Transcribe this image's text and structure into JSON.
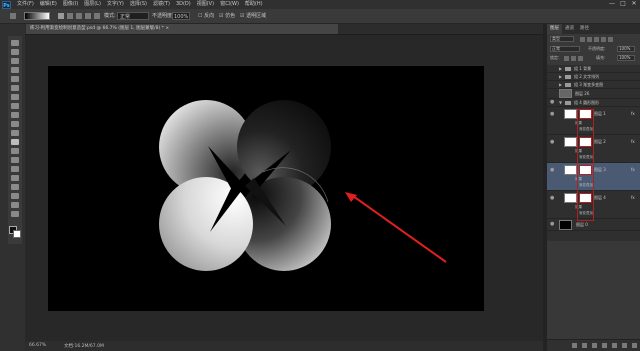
{
  "app": {
    "logo": "Ps"
  },
  "menu": [
    "文件(F)",
    "编辑(E)",
    "图像(I)",
    "图层(L)",
    "文字(Y)",
    "选择(S)",
    "滤镜(T)",
    "3D(D)",
    "视图(V)",
    "窗口(W)",
    "帮助(H)"
  ],
  "window_controls": [
    "—",
    "□",
    "✕"
  ],
  "options_bar": {
    "mode_label": "模式:",
    "mode_value": "正常",
    "opacity_label": "不透明度:",
    "opacity_value": "100%",
    "reverse_label": "反向",
    "dither_label": "仿色",
    "transparency_label": "透明区域"
  },
  "document_tab": {
    "title": "练习-利用渐变绘制创意造型.psd @ 66.7% (图层 1, 图层蒙版/8) * ×"
  },
  "status_bar": {
    "zoom": "66.67%",
    "doc_size": "文档:16.2M/67.0M"
  },
  "panels": {
    "tabs": [
      "图层",
      "通道",
      "路径"
    ],
    "kind_label": "类型",
    "mode_value": "正常",
    "opacity_label": "不透明度:",
    "opacity_value": "100%",
    "lock_label": "锁定:",
    "fill_label": "填充:",
    "fill_value": "100%",
    "layers": [
      {
        "name": "组 1 背景",
        "type": "group"
      },
      {
        "name": "组 2 文字排列",
        "type": "group"
      },
      {
        "name": "组 3 渐变多变图",
        "type": "group"
      },
      {
        "name": "图层 26",
        "type": "layer"
      },
      {
        "name": "组 4 圆形图形",
        "type": "group"
      },
      {
        "name": "图层 1",
        "type": "masked",
        "effects": "效果",
        "sub": "渐变叠加"
      },
      {
        "name": "图层 2",
        "type": "masked",
        "effects": "效果",
        "sub": "渐变叠加"
      },
      {
        "name": "图层 3",
        "type": "masked",
        "effects": "效果",
        "sub": "渐变叠加"
      },
      {
        "name": "图层 4",
        "type": "masked",
        "effects": "效果",
        "sub": "渐变叠加"
      },
      {
        "name": "图层 0",
        "type": "layer"
      }
    ]
  },
  "colors": {
    "canvas": "#000000",
    "arrow": "#e02020",
    "highlight": "#b02020"
  }
}
